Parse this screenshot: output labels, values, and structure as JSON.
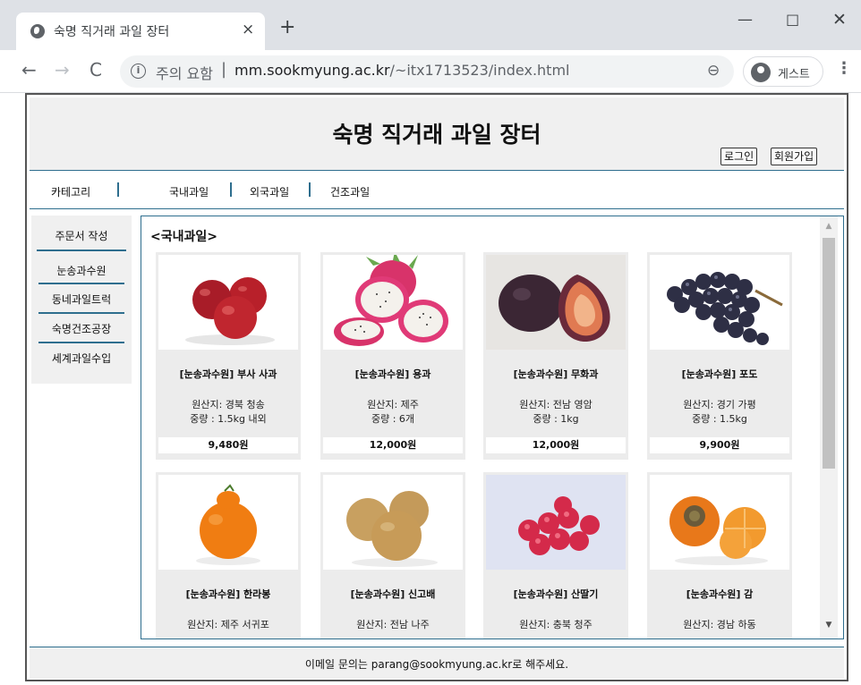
{
  "browser": {
    "tab_title": "숙명 직거래 과일 장터",
    "tab_close": "×",
    "new_tab": "+",
    "win_min": "—",
    "win_max": "☐",
    "win_close": "✕",
    "back": "←",
    "forward": "→",
    "reload": "C",
    "security_label": "주의 요함",
    "url_host": "mm.sookmyung.ac.kr",
    "url_path": "/~itx1713523/index.html",
    "zoom": "⊖",
    "profile_label": "게스트",
    "menu": "⋮"
  },
  "header": {
    "title": "숙명 직거래 과일 장터",
    "login": "로그인",
    "signup": "회원가입"
  },
  "nav": {
    "category": "카테고리",
    "items": [
      "국내과일",
      "외국과일",
      "건조과일"
    ]
  },
  "sidebar": {
    "order": "주문서 작성",
    "items": [
      "눈송과수원",
      "동네과일트럭",
      "숙명건조공장",
      "세계과일수입"
    ]
  },
  "content": {
    "title": "<국내과일>",
    "products": [
      {
        "name": "[눈송과수원] 부사 사과",
        "origin": "원산지: 경북 청송",
        "weight": "중량 : 1.5kg 내외",
        "price": "9,480원",
        "image": "apple"
      },
      {
        "name": "[눈송과수원] 용과",
        "origin": "원산지: 제주",
        "weight": "중량 : 6개",
        "price": "12,000원",
        "image": "dragonfruit"
      },
      {
        "name": "[눈송과수원] 무화과",
        "origin": "원산지: 전남 영암",
        "weight": "중량 : 1kg",
        "price": "12,000원",
        "image": "fig"
      },
      {
        "name": "[눈송과수원] 포도",
        "origin": "원산지: 경기 가평",
        "weight": "중량 : 1.5kg",
        "price": "9,900원",
        "image": "grape"
      },
      {
        "name": "[눈송과수원] 한라봉",
        "origin": "원산지: 제주 서귀포",
        "weight": "",
        "price": "",
        "image": "hallabong"
      },
      {
        "name": "[눈송과수원] 신고배",
        "origin": "원산지: 전남 나주",
        "weight": "",
        "price": "",
        "image": "pear"
      },
      {
        "name": "[눈송과수원] 산딸기",
        "origin": "원산지: 충북 청주",
        "weight": "",
        "price": "",
        "image": "raspberry"
      },
      {
        "name": "[눈송과수원] 감",
        "origin": "원산지: 경남 하동",
        "weight": "",
        "price": "",
        "image": "persimmon"
      }
    ]
  },
  "footer": {
    "text": "이메일 문의는 parang@sookmyung.ac.kr로 해주세요."
  }
}
